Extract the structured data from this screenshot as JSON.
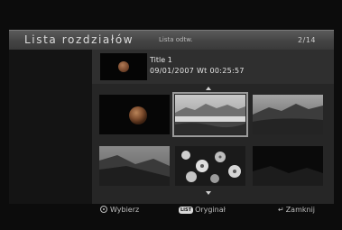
{
  "header": {
    "title": "Lista rozdziałów",
    "subtitle": "Lista odtw.",
    "page_indicator": "2/14"
  },
  "info": {
    "title": "Title 1",
    "datetime": "09/01/2007  Wt  00:25:57"
  },
  "thumbnails": [
    {
      "scene": "orb-on-black",
      "selected": false
    },
    {
      "scene": "mountain-lake",
      "selected": true
    },
    {
      "scene": "dusk-hills",
      "selected": false
    },
    {
      "scene": "grassy-slope",
      "selected": false
    },
    {
      "scene": "white-flowers",
      "selected": false
    },
    {
      "scene": "dark-valley",
      "selected": false
    }
  ],
  "footer": {
    "select_label": "Wybierz",
    "select_icon": "enter-circle-icon",
    "list_badge": "LIST",
    "original_label": "Oryginał",
    "close_label": "Zamknij",
    "close_icon": "return-icon"
  },
  "colors": {
    "background": "#0c0c0c",
    "header": "#4a4a4a",
    "panel": "#262626",
    "selection_border": "#9a9a9a"
  }
}
